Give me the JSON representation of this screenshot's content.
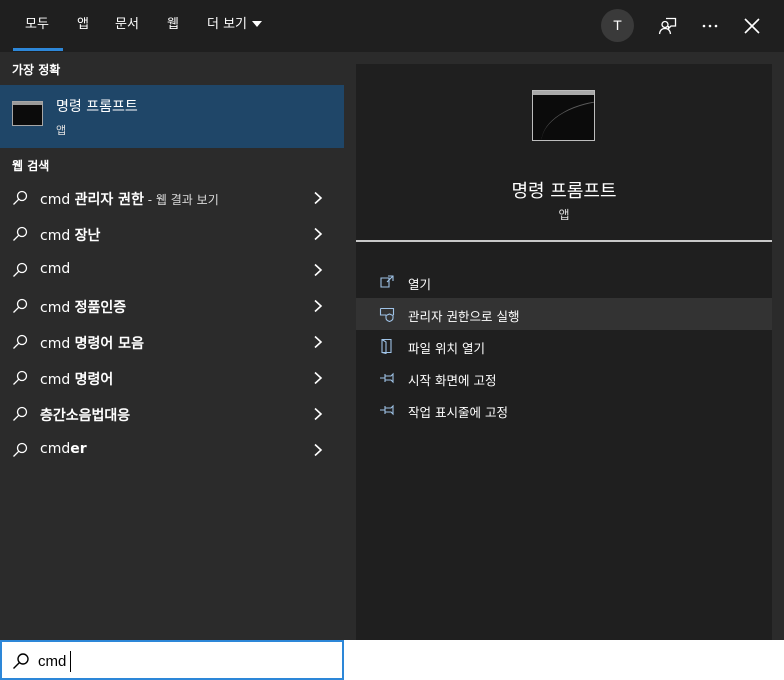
{
  "tabs": [
    {
      "label": "모두",
      "active": true
    },
    {
      "label": "앱"
    },
    {
      "label": "문서"
    },
    {
      "label": "웹"
    },
    {
      "label": "더 보기"
    }
  ],
  "header": {
    "avatar_initial": "T",
    "icons": [
      "feedback-icon",
      "more-options-icon",
      "close-icon"
    ]
  },
  "left": {
    "best_match_title": "가장 정확",
    "best_match": {
      "name": "명령 프롬프트",
      "type": "앱",
      "icon": "command-prompt-icon"
    },
    "web_title": "웹 검색",
    "suggestions": [
      {
        "prefix": "cmd ",
        "bold": "관리자 권한",
        "hint": " - 웹 결과 보기"
      },
      {
        "prefix": "cmd ",
        "bold": "장난",
        "hint": ""
      },
      {
        "prefix": "cmd",
        "bold": "",
        "hint": ""
      },
      {
        "prefix": "cmd ",
        "bold": "정품인증",
        "hint": ""
      },
      {
        "prefix": "cmd ",
        "bold": "명령어 모음",
        "hint": ""
      },
      {
        "prefix": "cmd ",
        "bold": "명령어",
        "hint": ""
      },
      {
        "prefix": "",
        "bold": "층간소음법대응",
        "hint": ""
      },
      {
        "prefix": "cmd",
        "bold": "er",
        "hint": ""
      }
    ]
  },
  "right": {
    "app_name": "명령 프롬프트",
    "app_type": "앱",
    "actions": [
      {
        "label": "열기",
        "icon": "open-icon"
      },
      {
        "label": "관리자 권한으로 실행",
        "icon": "shield-icon"
      },
      {
        "label": "파일 위치 열기",
        "icon": "file-location-icon"
      },
      {
        "label": "시작 화면에 고정",
        "icon": "pin-icon"
      },
      {
        "label": "작업 표시줄에 고정",
        "icon": "pin-icon"
      }
    ]
  },
  "search": {
    "value": "cmd",
    "icon": "search-icon"
  },
  "colors": {
    "accent": "#2d87d8",
    "selected": "#1f4668",
    "panel": "#2b2b2b",
    "topbar": "#1f1f1f"
  }
}
